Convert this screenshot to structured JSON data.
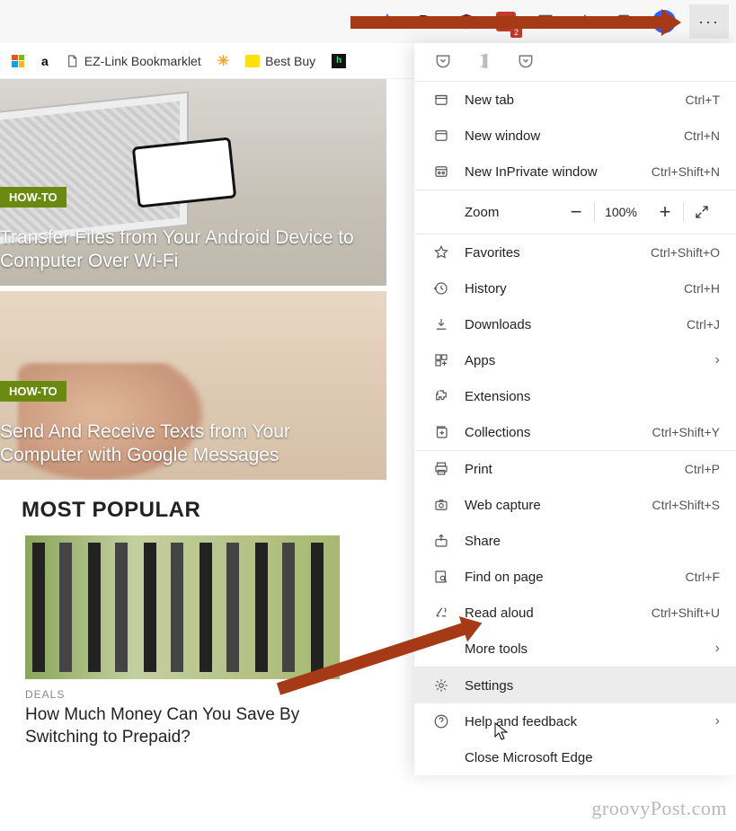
{
  "toolbar": {
    "d_label": "D.",
    "badge": "2",
    "more_glyph": "···"
  },
  "bookmarks": {
    "ezlink": "EZ-Link Bookmarklet",
    "bestbuy": "Best Buy",
    "amazon_glyph": "a",
    "hulu_h": "h"
  },
  "page": {
    "howto": "HOW-TO",
    "article1_title": "Transfer Files from Your Android Device to Computer Over Wi-Fi",
    "article2_title": "Send And Receive Texts from Your Computer with Google Messages",
    "section_most_popular": "MOST POPULAR",
    "deals_cat": "DEALS",
    "mp_title": "How Much Money Can You Save By Switching to Prepaid?"
  },
  "menu": {
    "new_tab": {
      "label": "New tab",
      "shortcut": "Ctrl+T"
    },
    "new_window": {
      "label": "New window",
      "shortcut": "Ctrl+N"
    },
    "new_inprivate": {
      "label": "New InPrivate window",
      "shortcut": "Ctrl+Shift+N"
    },
    "zoom_label": "Zoom",
    "zoom_value": "100%",
    "favorites": {
      "label": "Favorites",
      "shortcut": "Ctrl+Shift+O"
    },
    "history": {
      "label": "History",
      "shortcut": "Ctrl+H"
    },
    "downloads": {
      "label": "Downloads",
      "shortcut": "Ctrl+J"
    },
    "apps": {
      "label": "Apps"
    },
    "extensions": {
      "label": "Extensions"
    },
    "collections": {
      "label": "Collections",
      "shortcut": "Ctrl+Shift+Y"
    },
    "print": {
      "label": "Print",
      "shortcut": "Ctrl+P"
    },
    "web_capture": {
      "label": "Web capture",
      "shortcut": "Ctrl+Shift+S"
    },
    "share": {
      "label": "Share"
    },
    "find": {
      "label": "Find on page",
      "shortcut": "Ctrl+F"
    },
    "read_aloud": {
      "label": "Read aloud",
      "shortcut": "Ctrl+Shift+U"
    },
    "more_tools": {
      "label": "More tools"
    },
    "settings": {
      "label": "Settings"
    },
    "help": {
      "label": "Help and feedback"
    },
    "close_edge": {
      "label": "Close Microsoft Edge"
    }
  },
  "watermark": "groovyPost.com"
}
